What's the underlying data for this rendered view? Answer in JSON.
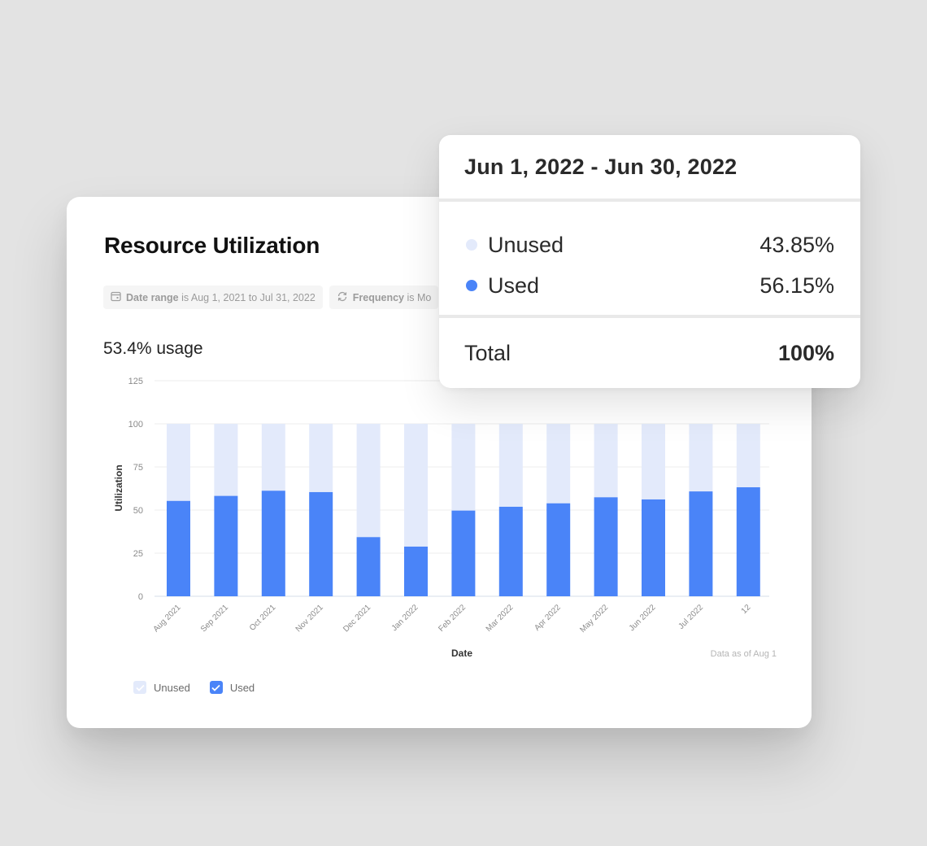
{
  "card": {
    "title": "Resource Utilization",
    "filters": [
      {
        "icon": "calendar-icon",
        "key": "Date range",
        "text": " is Aug 1, 2021 to Jul 31, 2022"
      },
      {
        "icon": "refresh-icon",
        "key": "Frequency",
        "text": " is Mo"
      }
    ],
    "usage_summary": "53.4% usage",
    "footnote": "Data as of Aug 1",
    "legend": [
      {
        "label": "Unused",
        "checked": true
      },
      {
        "label": "Used",
        "checked": true
      }
    ]
  },
  "colors": {
    "used": "#4a84f8",
    "unused": "#e3eafb",
    "grid": "#ececec",
    "axis": "#d5dce8"
  },
  "tooltip": {
    "period": "Jun 1, 2022 - Jun 30, 2022",
    "rows": [
      {
        "label": "Unused",
        "value": "43.85%"
      },
      {
        "label": "Used",
        "value": "56.15%"
      }
    ],
    "total_label": "Total",
    "total_value": "100%"
  },
  "chart_data": {
    "type": "bar",
    "stacked": true,
    "title": "",
    "xlabel": "Date",
    "ylabel": "Utilization",
    "ylim": [
      0,
      125
    ],
    "yticks": [
      0,
      25,
      50,
      75,
      100,
      125
    ],
    "grid": true,
    "legend_position": "bottom-left",
    "categories": [
      "Aug 2021",
      "Sep 2021",
      "Oct 2021",
      "Nov 2021",
      "Dec 2021",
      "Jan 2022",
      "Feb 2022",
      "Mar 2022",
      "Apr 2022",
      "May 2022",
      "Jun 2022",
      "Jul 2022",
      "12"
    ],
    "series": [
      {
        "name": "Used",
        "values": [
          55.3,
          58.2,
          61.2,
          60.4,
          34.3,
          28.8,
          49.7,
          51.9,
          53.9,
          57.4,
          56.15,
          60.8,
          63.2
        ]
      },
      {
        "name": "Unused",
        "values": [
          44.7,
          41.8,
          38.8,
          39.6,
          65.7,
          71.2,
          50.3,
          48.1,
          46.1,
          42.6,
          43.85,
          39.2,
          36.8
        ]
      }
    ]
  }
}
